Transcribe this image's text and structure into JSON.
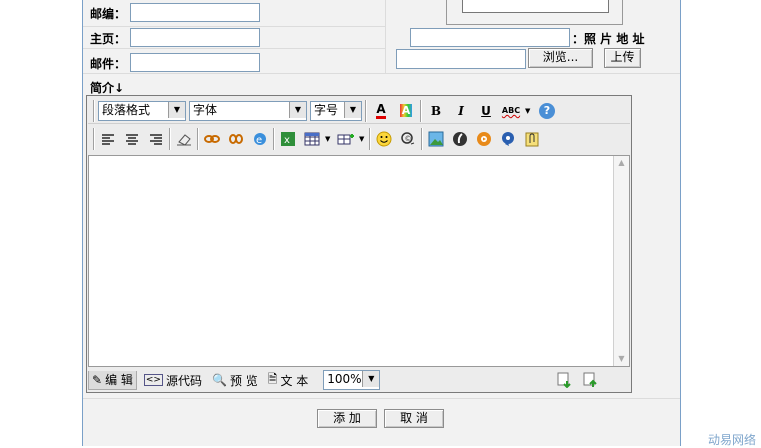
{
  "form": {
    "zip_label": "邮编：",
    "homepage_label": "主页：",
    "email_label": "邮件：",
    "bio_label": "简介↓",
    "photo_label": "：照 片 地 址",
    "browse_button": "浏览...",
    "upload_button": "上传"
  },
  "editor": {
    "paragraph_format": "段落格式",
    "font": "字体",
    "font_size": "字号",
    "zoom": "100%",
    "mode_tabs": [
      "编 辑",
      "源代码",
      "预 览",
      "文 本"
    ]
  },
  "actions": {
    "add": "添 加",
    "cancel": "取 消"
  },
  "watermark": "动易网络"
}
